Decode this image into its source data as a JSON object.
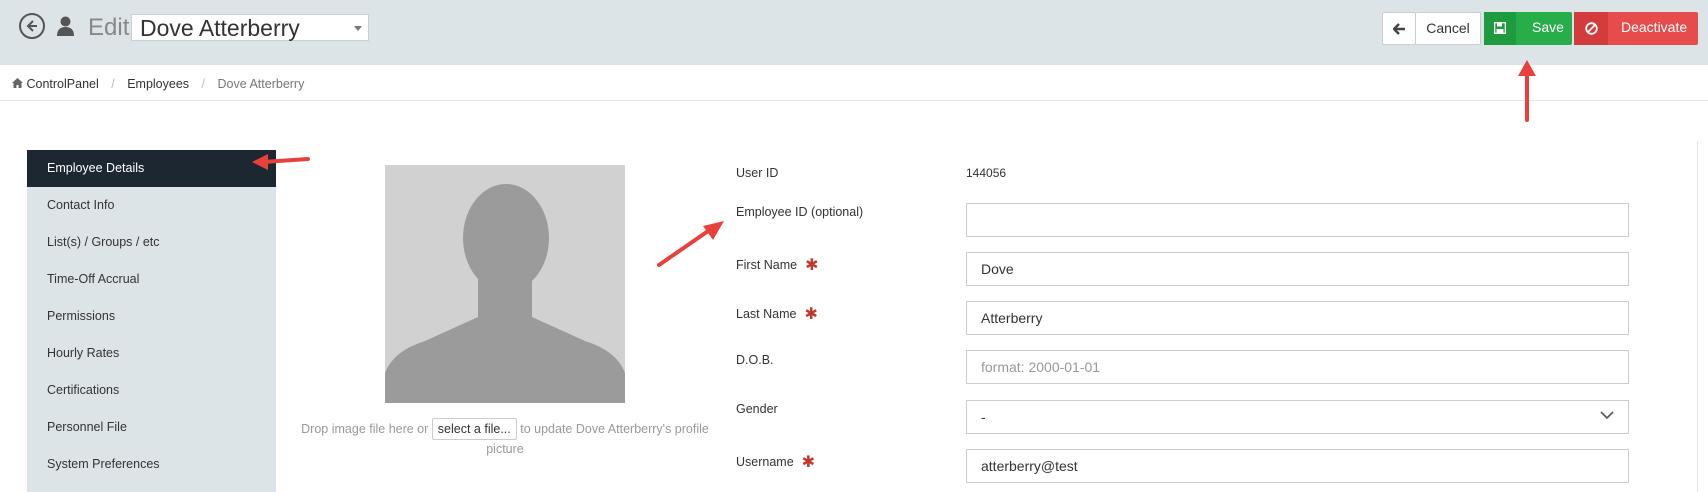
{
  "header": {
    "edit_label": "Edit",
    "employee_name": "Dove Atterberry",
    "cancel_label": "Cancel",
    "save_label": "Save",
    "deactivate_label": "Deactivate"
  },
  "breadcrumb": {
    "home": "ControlPanel",
    "section": "Employees",
    "current": "Dove Atterberry"
  },
  "sidebar": {
    "items": [
      {
        "label": "Employee Details",
        "active": true
      },
      {
        "label": "Contact Info"
      },
      {
        "label": "List(s) / Groups / etc"
      },
      {
        "label": "Time-Off Accrual"
      },
      {
        "label": "Permissions"
      },
      {
        "label": "Hourly Rates"
      },
      {
        "label": "Certifications"
      },
      {
        "label": "Personnel File"
      },
      {
        "label": "System Preferences"
      }
    ]
  },
  "photo": {
    "drop_prefix": "Drop image file here or",
    "select_file_label": "select a file...",
    "drop_suffix": "to update Dove Atterberry's profile picture"
  },
  "form": {
    "user_id_label": "User ID",
    "user_id_value": "144056",
    "employee_id_label": "Employee ID (optional)",
    "employee_id_value": "",
    "first_name_label": "First Name",
    "first_name_value": "Dove",
    "last_name_label": "Last Name",
    "last_name_value": "Atterberry",
    "dob_label": "D.O.B.",
    "dob_placeholder": "format: 2000-01-01",
    "gender_label": "Gender",
    "gender_value": "-",
    "username_label": "Username",
    "username_value": "atterberry@test",
    "required_mark": "✱"
  },
  "colors": {
    "header_bg": "#dde4e8",
    "save_green": "#27ae4a",
    "deactivate_red": "#e74c4c",
    "sidebar_active": "#1c2732",
    "annotation_arrow": "#e8413c"
  },
  "icons": [
    "back-circle-icon",
    "user-icon",
    "arrow-left-icon",
    "save-icon",
    "ban-icon",
    "home-icon",
    "chevron-down-icon"
  ]
}
